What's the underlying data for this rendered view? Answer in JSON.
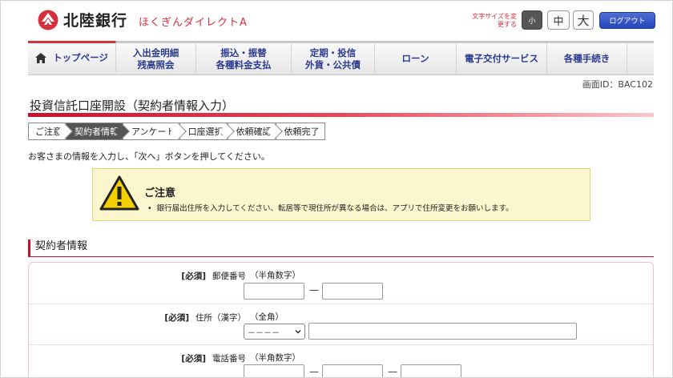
{
  "header": {
    "bank_name": "北陸銀行",
    "service_name": "ほくぎんダイレクトA",
    "font_size_label": "文字サイズを変更する",
    "font_size_small": "小",
    "font_size_medium": "中",
    "font_size_large": "大",
    "logout_label": "ログアウト"
  },
  "nav": {
    "items": [
      {
        "label": "トップページ",
        "icon": "house-icon"
      },
      {
        "label": "入出金明細\n残高照会"
      },
      {
        "label": "振込・振替\n各種料金支払"
      },
      {
        "label": "定期・投信\n外貨・公共債"
      },
      {
        "label": "ローン"
      },
      {
        "label": "電子交付サービス"
      },
      {
        "label": "各種手続き"
      }
    ]
  },
  "screen_id": "画面ID：BAC102",
  "page_title": "投資信託口座開設（契約者情報入力）",
  "steps": [
    "ご注意",
    "契約者情報",
    "アンケート",
    "口座選択",
    "依頼確認",
    "依頼完了"
  ],
  "current_step": "契約者情報",
  "intro": "お客さまの情報を入力し、「次へ」ボタンを押してください。",
  "notice": {
    "title": "ご注意",
    "text": "銀行届出住所を入力してください、転居等で現住所が異なる場合は、アプリで住所変更をお願いします。"
  },
  "section_title": "契約者情報",
  "form": {
    "postal": {
      "required": "[必須]",
      "label": "郵便番号",
      "hint": "（半角数字）",
      "value1": "",
      "value2": "",
      "separator": "—"
    },
    "address": {
      "required": "[必須]",
      "label": "住所（漢字）",
      "hint": "（全角）",
      "select_value": "－－－－",
      "value": ""
    },
    "phone": {
      "required": "[必須]",
      "label": "電話番号",
      "hint": "（半角数字）",
      "value1": "",
      "value2": "",
      "value3": "",
      "separator": "—"
    }
  },
  "colors": {
    "brand_red": "#c8102e",
    "nav_text": "#2a3a8f",
    "logout_blue": "#2447b8",
    "notice_bg": "#fcf6cf"
  }
}
